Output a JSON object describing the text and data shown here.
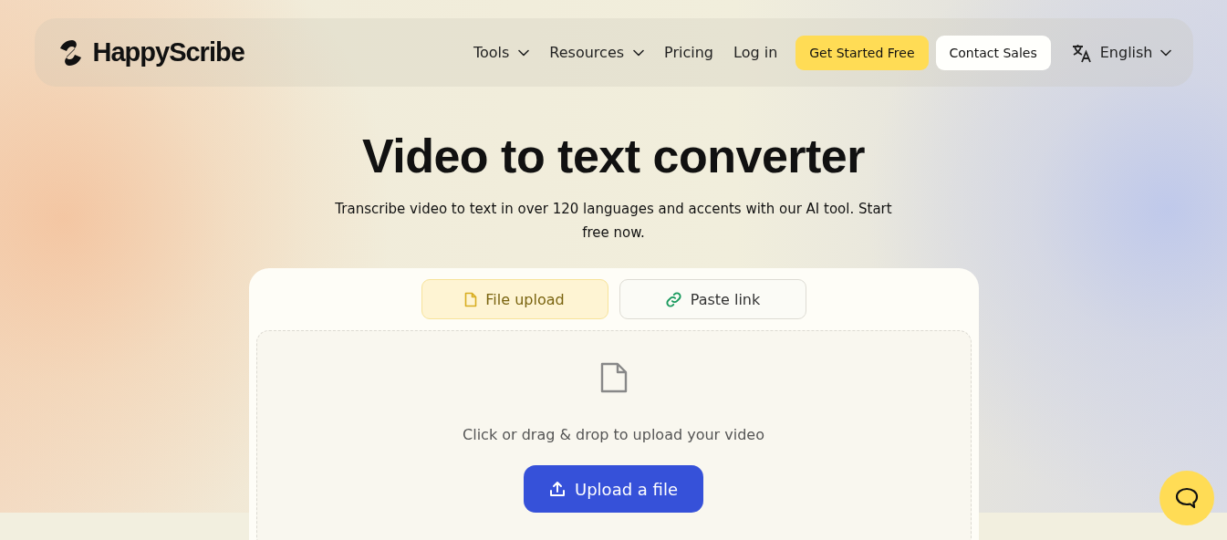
{
  "nav": {
    "brand": "HappyScribe",
    "links": [
      {
        "label": "Tools",
        "has_menu": true
      },
      {
        "label": "Resources",
        "has_menu": true
      },
      {
        "label": "Pricing",
        "has_menu": false
      },
      {
        "label": "Log in",
        "has_menu": false
      }
    ],
    "primary_button": "Get Started Free",
    "secondary_button": "Contact Sales",
    "language": "English"
  },
  "hero": {
    "title": "Video to text converter",
    "subtitle": "Transcribe video to text in over 120 languages and accents with our AI tool. Start free now."
  },
  "uploader": {
    "tabs": [
      {
        "label": "File upload",
        "kind": "file",
        "selected": true
      },
      {
        "label": "Paste link",
        "kind": "link",
        "selected": false
      }
    ],
    "hint": "Click or drag & drop to upload your video",
    "button": "Upload a file"
  }
}
